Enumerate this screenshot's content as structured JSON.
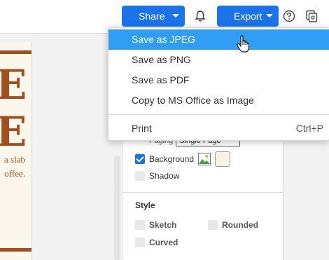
{
  "toolbar": {
    "share_label": "Share",
    "export_label": "Export"
  },
  "canvas": {
    "letter1": "E",
    "letter2": "E",
    "text_line1": "a slab",
    "text_line2": "offee."
  },
  "menu": {
    "items": [
      {
        "label": "Save as JPEG"
      },
      {
        "label": "Save as PNG"
      },
      {
        "label": "Save as PDF"
      },
      {
        "label": "Copy to MS Office as Image"
      }
    ],
    "print": {
      "label": "Print",
      "shortcut": "Ctrl+P"
    }
  },
  "panel": {
    "paging_label": "Paging",
    "paging_value": "Single Page",
    "background_label": "Background",
    "shadow_label": "Shadow",
    "style_title": "Style",
    "sketch_label": "Sketch",
    "rounded_label": "Rounded",
    "curved_label": "Curved",
    "background_color": "#f7f4e6"
  },
  "colors": {
    "accent": "#1a73e8",
    "menu_highlight": "#2f9ef4",
    "canvas_brown": "#a24f1c"
  }
}
